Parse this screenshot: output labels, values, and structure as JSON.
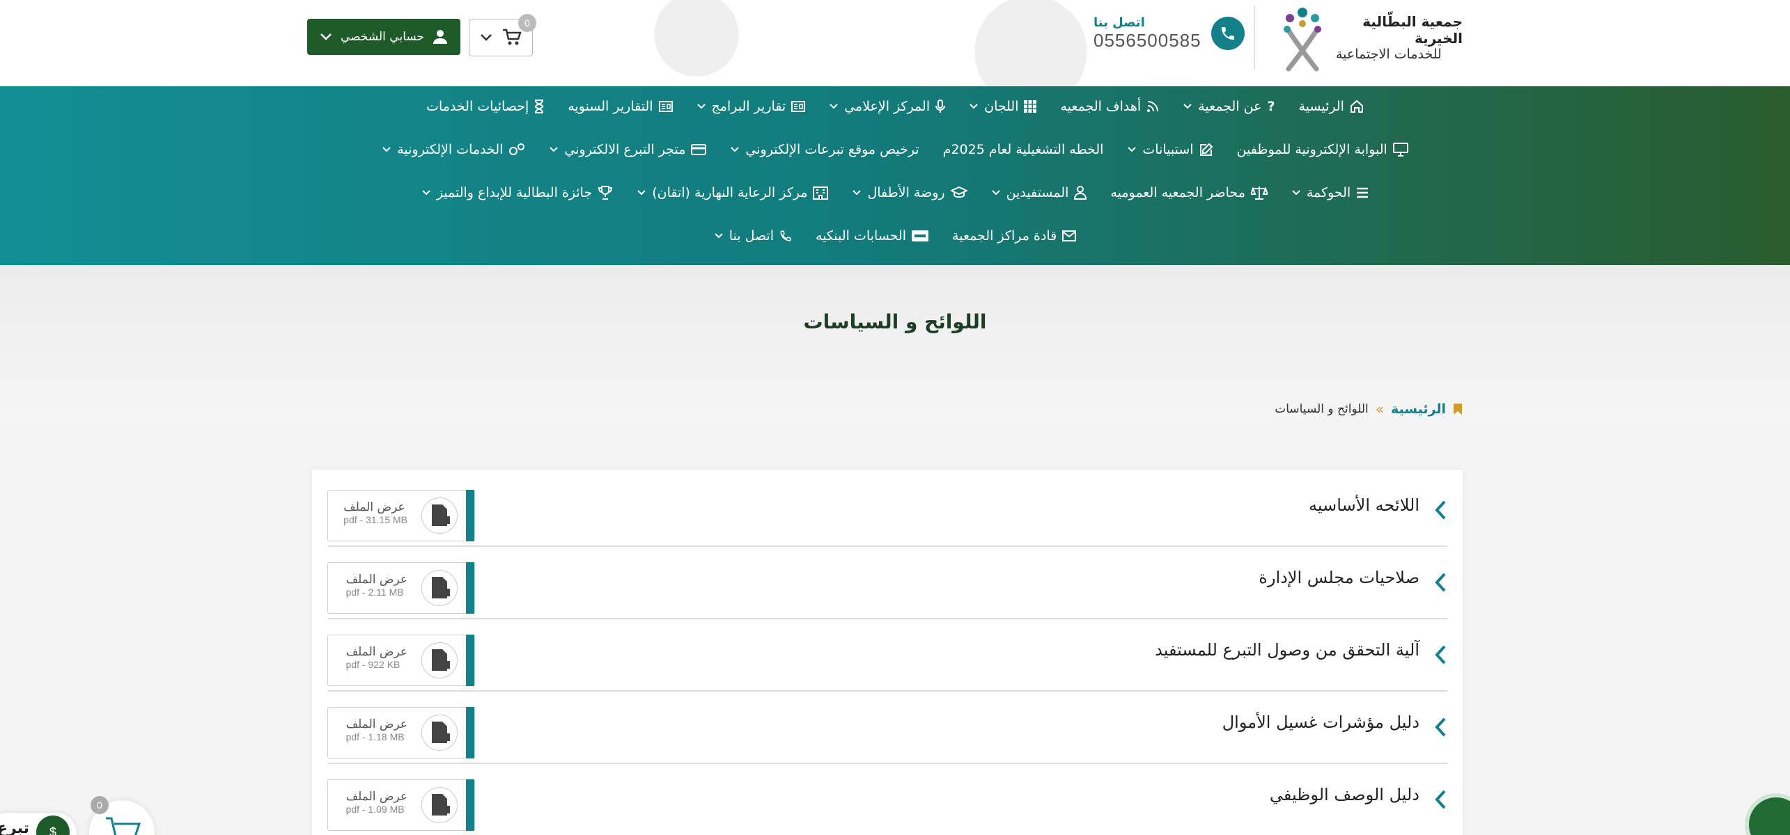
{
  "header": {
    "logo_line1": "جمعية البطّالية الخيرية",
    "logo_line2": "للخدمات الاجتماعية",
    "contact_label": "اتصل بنا",
    "contact_phone": "0556500585",
    "account_label": "حسابي الشخصي",
    "cart_count": "0"
  },
  "nav": {
    "row1": [
      {
        "label": "الرئيسية",
        "icon": "home-icon",
        "dropdown": false
      },
      {
        "label": "عن الجمعية",
        "icon": "question-icon",
        "dropdown": true
      },
      {
        "label": "أهداف الجمعيه",
        "icon": "rss-icon",
        "dropdown": false
      },
      {
        "label": "اللجان",
        "icon": "grid-icon",
        "dropdown": true
      },
      {
        "label": "المركز الإعلامي",
        "icon": "microphone-icon",
        "dropdown": true
      },
      {
        "label": "تقارير البرامج",
        "icon": "report-icon",
        "dropdown": true
      },
      {
        "label": "التقارير السنويه",
        "icon": "report-icon",
        "dropdown": false
      },
      {
        "label": "إحصائيات الخدمات",
        "icon": "hourglass-icon",
        "dropdown": false
      }
    ],
    "row2": [
      {
        "label": "البوابة الإلكترونية للموظفين",
        "icon": "monitor-icon",
        "dropdown": false
      },
      {
        "label": "استبيانات",
        "icon": "edit-icon",
        "dropdown": true
      },
      {
        "label": "الخطه التشغيلية لعام 2025م",
        "icon": "",
        "dropdown": false
      },
      {
        "label": "ترخيص موقع تبرعات الإلكتروني",
        "icon": "",
        "dropdown": true
      },
      {
        "label": "متجر التبرع الالكتروني",
        "icon": "card-icon",
        "dropdown": true
      },
      {
        "label": "الخدمات الإلكترونية",
        "icon": "cogs-icon",
        "dropdown": true
      }
    ],
    "row3": [
      {
        "label": "الحوكمة",
        "icon": "list-icon",
        "dropdown": true
      },
      {
        "label": "محاضر الجمعيه العموميه",
        "icon": "scale-icon",
        "dropdown": false
      },
      {
        "label": "المستفيدين",
        "icon": "user-icon",
        "dropdown": true
      },
      {
        "label": "روضة الأطفال",
        "icon": "graduation-icon",
        "dropdown": true
      },
      {
        "label": "مركز الرعاية النهارية (اتقان)",
        "icon": "building-icon",
        "dropdown": true
      },
      {
        "label": "جائزة البطالية للإبداع والتميز",
        "icon": "trophy-icon",
        "dropdown": true
      }
    ],
    "row4": [
      {
        "label": "قادة مراكز الجمعية",
        "icon": "envelope-icon",
        "dropdown": false
      },
      {
        "label": "الحسابات البنكيه",
        "icon": "visa-icon",
        "dropdown": false
      },
      {
        "label": "اتصل بنا",
        "icon": "phone-icon",
        "dropdown": true
      }
    ]
  },
  "page": {
    "title": "اللوائح و السياسات",
    "breadcrumb_home": "الرئيسية",
    "breadcrumb_current": "اللوائح و السياسات"
  },
  "documents": [
    {
      "title": "اللائحه الأساسيه",
      "action": "عرض الملف",
      "meta": "pdf - 31.15 MB"
    },
    {
      "title": "صلاحيات مجلس الإدارة",
      "action": "عرض الملف",
      "meta": "pdf - 2.11 MB"
    },
    {
      "title": "آلية التحقق من وصول التبرع للمستفيد",
      "action": "عرض الملف",
      "meta": "pdf - 922 KB"
    },
    {
      "title": "دليل مؤشرات غسيل الأموال",
      "action": "عرض الملف",
      "meta": "pdf - 1.18 MB"
    },
    {
      "title": "دليل الوصف الوظيفي",
      "action": "عرض الملف",
      "meta": "pdf - 1.09 MB"
    }
  ],
  "floating": {
    "cart_count": "0",
    "donate_label": "تبرع",
    "donate_symbol": "$"
  },
  "colors": {
    "teal": "#13808a",
    "green": "#1f5a2a",
    "gold": "#d49c2a"
  }
}
